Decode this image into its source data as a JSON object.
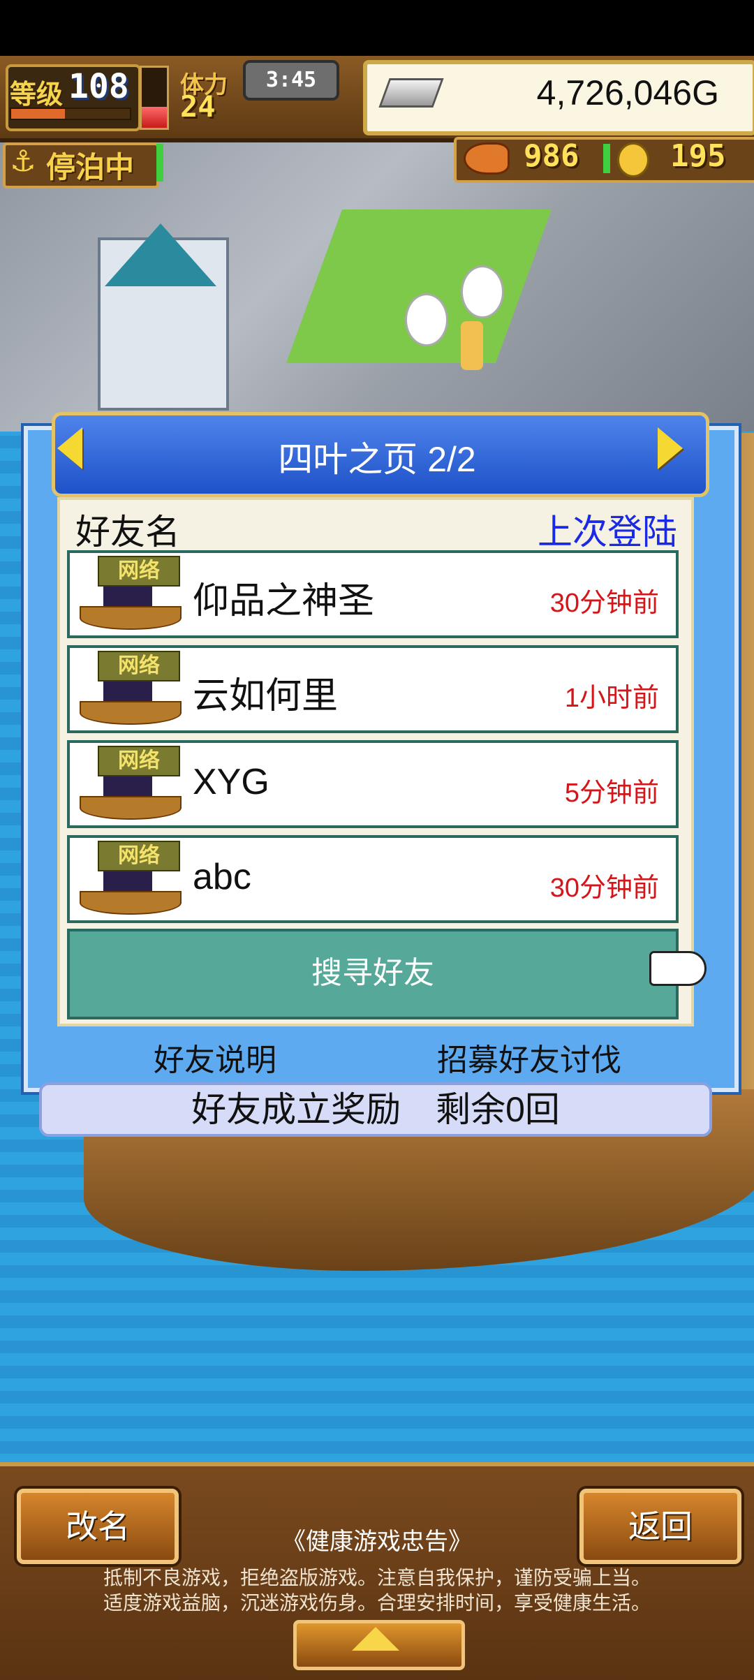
{
  "hud": {
    "level_label": "等级",
    "level_value": "108",
    "exp_fraction": 0.45,
    "stamina_fraction": 0.35,
    "stamina_label": "体力",
    "stamina_value": "24",
    "timer": "3:45",
    "gold": "4,726,046G",
    "status": "停泊中",
    "resource_a": "986",
    "resource_b": "195"
  },
  "dialog": {
    "title": "四叶之页 2/2",
    "col_name": "好友名",
    "col_last_login": "上次登陆",
    "rows": [
      {
        "badge": "网络",
        "name": "仰品之神圣",
        "last_login": "30分钟前"
      },
      {
        "badge": "网络",
        "name": "云如何里",
        "last_login": "1小时前"
      },
      {
        "badge": "网络",
        "name": "XYG",
        "last_login": "5分钟前"
      },
      {
        "badge": "网络",
        "name": "abc",
        "last_login": "30分钟前"
      }
    ],
    "search_button": "搜寻好友",
    "friend_help": "好友说明",
    "recruit": "招募好友讨伐",
    "reward": "好友成立奖励　剩余0回"
  },
  "bottom": {
    "rename_button": "改名",
    "back_button": "返回",
    "notice_title": "《健康游戏忠告》",
    "notice_line1": "抵制不良游戏，拒绝盗版游戏。注意自我保护，谨防受骗上当。",
    "notice_line2": "适度游戏益脑，沉迷游戏伤身。合理安排时间，享受健康生活。"
  },
  "colors": {
    "login_time": "#d4161a",
    "last_login_header": "#1a2ae4",
    "search_button_bg": "#56a898"
  }
}
